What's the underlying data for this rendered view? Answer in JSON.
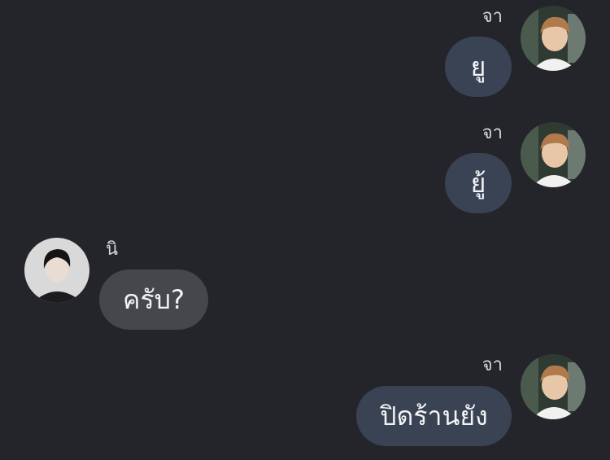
{
  "chat": {
    "messages": [
      {
        "direction": "outgoing",
        "sender": "จา",
        "text": "ยู",
        "avatar": "sender-a-avatar"
      },
      {
        "direction": "outgoing",
        "sender": "จา",
        "text": "ยู้",
        "avatar": "sender-a-avatar"
      },
      {
        "direction": "incoming",
        "sender": "นิ",
        "text": "ครับ?",
        "avatar": "sender-b-avatar"
      },
      {
        "direction": "outgoing",
        "sender": "จา",
        "text": "ปิดร้านยัง",
        "avatar": "sender-a-avatar"
      }
    ]
  },
  "colors": {
    "background": "#24252b",
    "outgoing_bubble": "#3a4354",
    "incoming_bubble": "#46474d",
    "text": "#f2f3f5"
  }
}
